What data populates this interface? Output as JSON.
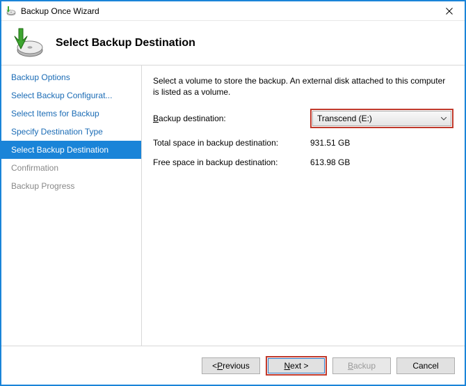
{
  "window": {
    "title": "Backup Once Wizard"
  },
  "header": {
    "title": "Select Backup Destination"
  },
  "sidebar": {
    "items": [
      {
        "label": "Backup Options",
        "state": "link"
      },
      {
        "label": "Select Backup Configurat...",
        "state": "link"
      },
      {
        "label": "Select Items for Backup",
        "state": "link"
      },
      {
        "label": "Specify Destination Type",
        "state": "link"
      },
      {
        "label": "Select Backup Destination",
        "state": "selected"
      },
      {
        "label": "Confirmation",
        "state": "disabled"
      },
      {
        "label": "Backup Progress",
        "state": "disabled"
      }
    ]
  },
  "content": {
    "intro": "Select a volume to store the backup. An external disk attached to this computer is listed as a volume.",
    "dest_label_pre": "B",
    "dest_label_post": "ackup destination:",
    "dest_value": "Transcend (E:)",
    "total_label": "Total space in backup destination:",
    "total_value": "931.51 GB",
    "free_label": "Free space in backup destination:",
    "free_value": "613.98 GB"
  },
  "footer": {
    "prev_pre": "< ",
    "prev_u": "P",
    "prev_post": "revious",
    "next_u": "N",
    "next_post": "ext >",
    "backup_u": "B",
    "backup_post": "ackup",
    "cancel": "Cancel"
  }
}
